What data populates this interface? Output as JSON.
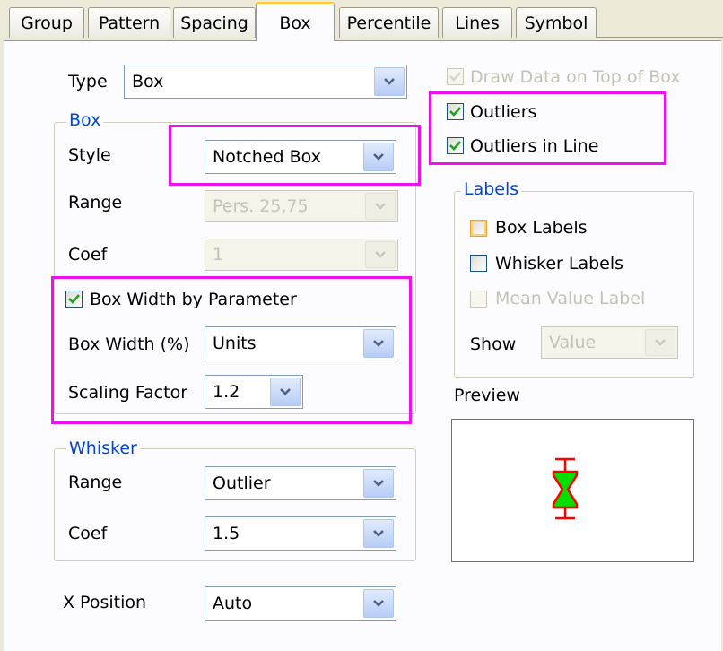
{
  "tabs": [
    "Group",
    "Pattern",
    "Spacing",
    "Box",
    "Percentile",
    "Lines",
    "Symbol"
  ],
  "active_tab": "Box",
  "type": {
    "label": "Type",
    "value": "Box"
  },
  "box_group": {
    "title": "Box",
    "style_label": "Style",
    "style_value": "Notched Box",
    "range_label": "Range",
    "range_value": "Pers. 25,75",
    "coef_label": "Coef",
    "coef_value": "1",
    "width_by_param_label": "Box Width by Parameter",
    "width_by_param_checked": true,
    "box_width_label": "Box Width (%)",
    "box_width_value": "Units",
    "scaling_label": "Scaling Factor",
    "scaling_value": "1.2"
  },
  "whisker_group": {
    "title": "Whisker",
    "range_label": "Range",
    "range_value": "Outlier",
    "coef_label": "Coef",
    "coef_value": "1.5"
  },
  "x_position": {
    "label": "X Position",
    "value": "Auto"
  },
  "draw_on_top": {
    "label": "Draw Data on Top of Box",
    "checked": false,
    "enabled": false
  },
  "outliers": {
    "label": "Outliers",
    "checked": true
  },
  "outliers_in_line": {
    "label": "Outliers in Line",
    "checked": true
  },
  "labels_group": {
    "title": "Labels",
    "box_labels": "Box Labels",
    "whisker_labels": "Whisker Labels",
    "mean_value_label": "Mean Value Label",
    "show_label": "Show",
    "show_value": "Value"
  },
  "preview": {
    "label": "Preview"
  },
  "colors": {
    "highlight": "#ee11ee",
    "group_title": "#0046d5",
    "preview_fill": "#00e000",
    "preview_stroke": "#ff0000",
    "check": "#21a121"
  }
}
